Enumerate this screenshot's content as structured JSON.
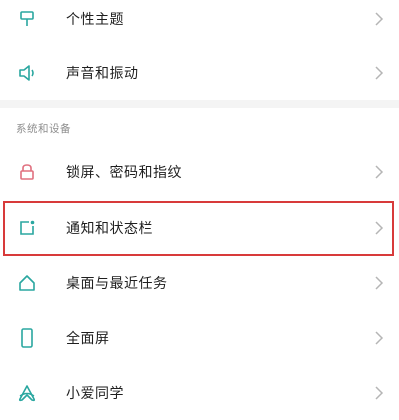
{
  "top_items": [
    {
      "label": "个性主题",
      "icon": "theme-icon"
    },
    {
      "label": "声音和振动",
      "icon": "speaker-icon"
    }
  ],
  "section": {
    "title": "系统和设备",
    "items": [
      {
        "label": "锁屏、密码和指纹",
        "icon": "lock-icon"
      },
      {
        "label": "通知和状态栏",
        "icon": "notification-icon"
      },
      {
        "label": "桌面与最近任务",
        "icon": "home-icon"
      },
      {
        "label": "全面屏",
        "icon": "fullscreen-phone-icon"
      },
      {
        "label": "小爱同学",
        "icon": "xiaoai-icon"
      }
    ]
  },
  "colors": {
    "icon_teal": "#2aa7a0",
    "icon_pink": "#e0707f",
    "highlight": "#d83a3a",
    "chevron": "#b5b5b5"
  }
}
